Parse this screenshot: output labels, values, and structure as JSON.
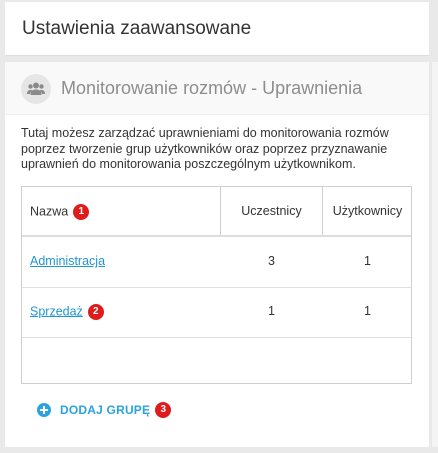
{
  "header": {
    "title": "Ustawienia zaawansowane"
  },
  "card": {
    "icon": "users-icon",
    "title": "Monitorowanie rozmów - Uprawnienia",
    "description": "Tutaj możesz zarządzać uprawnieniami do monitorowania rozmów poprzez tworzenie grup użytkowników oraz poprzez przyznawanie uprawnień do monitorowania poszczególnym użytkownikom."
  },
  "table": {
    "columns": {
      "name": "Nazwa",
      "participants": "Uczestnicy",
      "users": "Użytkownicy"
    },
    "rows": [
      {
        "name": "Administracja",
        "participants": "3",
        "users": "1"
      },
      {
        "name": "Sprzedaż",
        "participants": "1",
        "users": "1"
      }
    ]
  },
  "actions": {
    "add_group": "DODAJ GRUPĘ"
  },
  "badges": {
    "b1": "1",
    "b2": "2",
    "b3": "3"
  },
  "colors": {
    "accent": "#2aa3e0",
    "link": "#2196d3",
    "badge": "#e01b1b"
  }
}
